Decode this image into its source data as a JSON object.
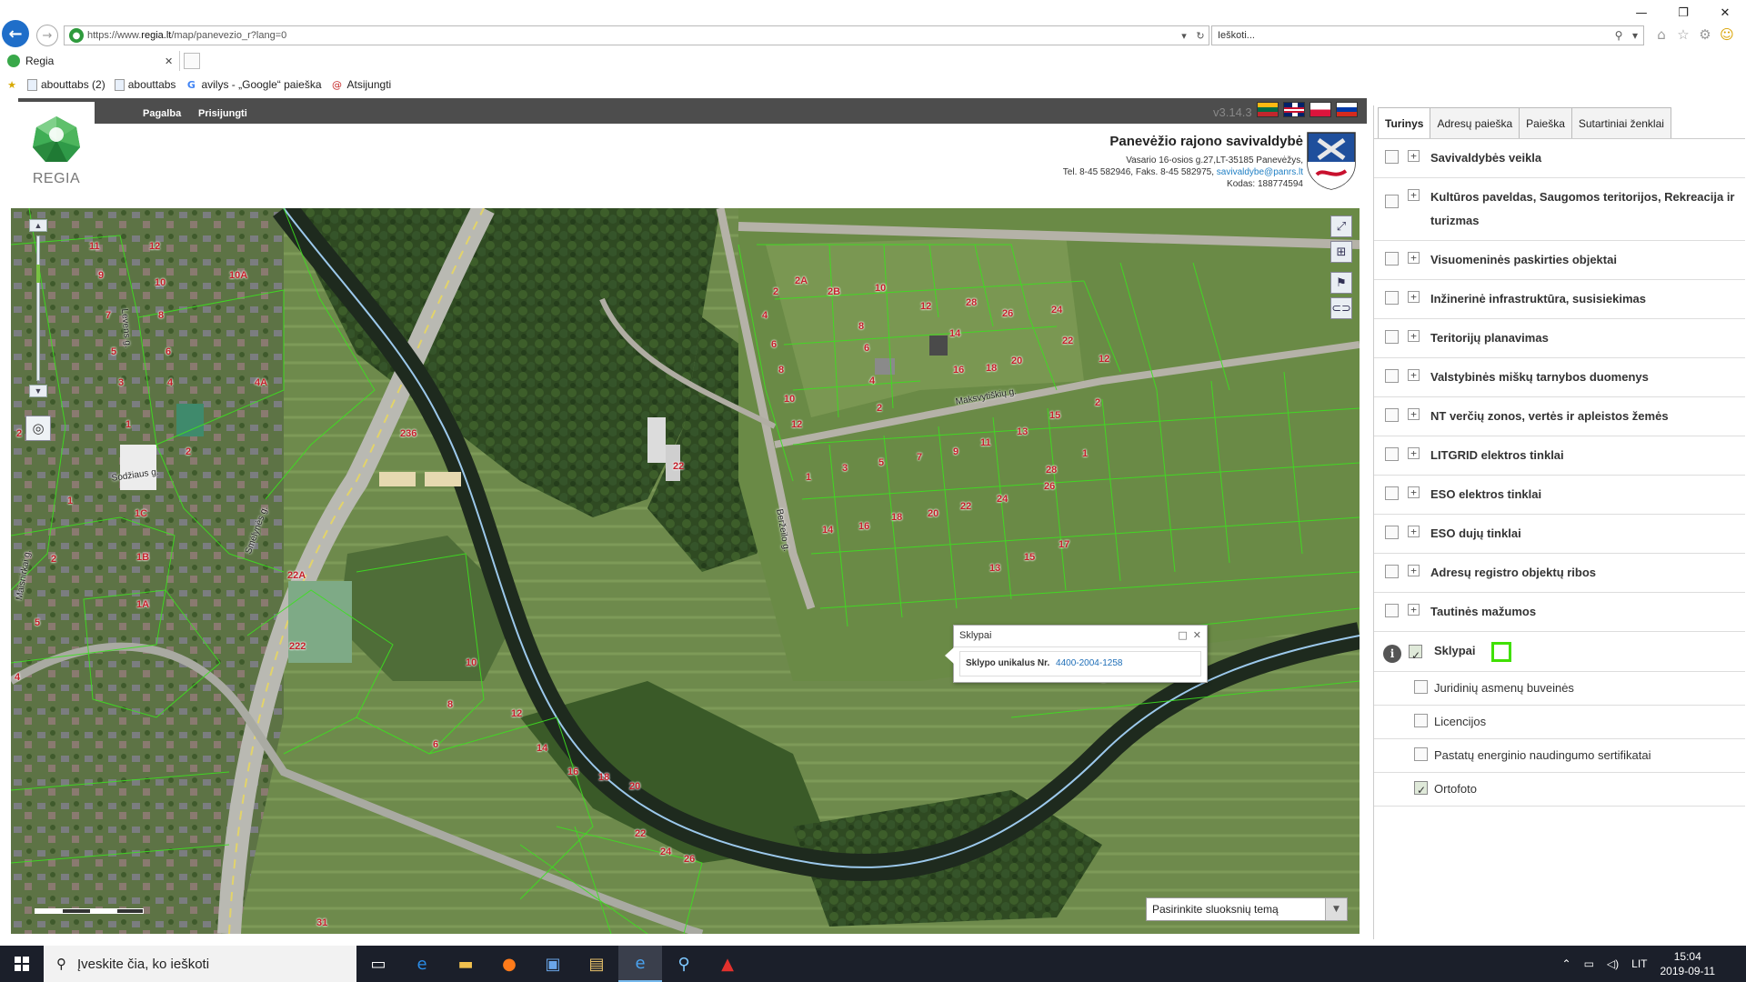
{
  "window": {
    "minimize": "—",
    "restore": "❐",
    "close": "✕"
  },
  "browser": {
    "url_prefix": "https://www.",
    "url_host": "regia.lt",
    "url_path": "/map/panevezio_r?lang=0",
    "search_placeholder": "Ieškoti...",
    "tab_title": "Regia",
    "favorites": [
      {
        "label": "abouttabs (2)",
        "icon": "page-icon"
      },
      {
        "label": "abouttabs",
        "icon": "page-icon"
      },
      {
        "label": "avilys - „Google“ paieška",
        "icon": "google-icon"
      },
      {
        "label": "Atsijungti",
        "icon": "at-icon"
      }
    ]
  },
  "app": {
    "logo_text": "REGIA",
    "menu": [
      "Pagalba",
      "Prisijungti"
    ],
    "version": "v3.14.3",
    "languages": [
      "lt",
      "en",
      "pl",
      "ru"
    ],
    "municipality": {
      "name": "Panevėžio rajono savivaldybė",
      "address": "Vasario 16-osios g.27,LT-35185 Panevėžys,",
      "phone_fax": "Tel. 8-45 582946, Faks. 8-45 582975,",
      "email": "savivaldybe@panrs.lt",
      "code": "Kodas: 188774594"
    }
  },
  "map": {
    "street_labels": [
      "Smėlynės g.",
      "Beržeilo g.",
      "Maksvytiškių g.",
      "Sodžiaus g.",
      "Levens g.",
      "Maisnirkai g."
    ],
    "parcel_labels": [
      {
        "t": "11"
      },
      {
        "t": "12"
      },
      {
        "t": "9"
      },
      {
        "t": "10"
      },
      {
        "t": "10A"
      },
      {
        "t": "7"
      },
      {
        "t": "8"
      },
      {
        "t": "5"
      },
      {
        "t": "6"
      },
      {
        "t": "3"
      },
      {
        "t": "4"
      },
      {
        "t": "4A"
      },
      {
        "t": "1"
      },
      {
        "t": "2"
      },
      {
        "t": "2"
      },
      {
        "t": "1"
      },
      {
        "t": "1C"
      },
      {
        "t": "1B"
      },
      {
        "t": "1A"
      },
      {
        "t": "2"
      },
      {
        "t": "5"
      },
      {
        "t": "4"
      },
      {
        "t": "236"
      },
      {
        "t": "22A"
      },
      {
        "t": "222"
      },
      {
        "t": "10"
      },
      {
        "t": "8"
      },
      {
        "t": "12"
      },
      {
        "t": "6"
      },
      {
        "t": "14"
      },
      {
        "t": "16"
      },
      {
        "t": "18"
      },
      {
        "t": "20"
      },
      {
        "t": "22"
      },
      {
        "t": "24"
      },
      {
        "t": "26"
      },
      {
        "t": "31"
      },
      {
        "t": "22"
      },
      {
        "t": "2"
      },
      {
        "t": "2A"
      },
      {
        "t": "2B"
      },
      {
        "t": "10"
      },
      {
        "t": "4"
      },
      {
        "t": "8"
      },
      {
        "t": "6"
      },
      {
        "t": "6"
      },
      {
        "t": "8"
      },
      {
        "t": "4"
      },
      {
        "t": "10"
      },
      {
        "t": "2"
      },
      {
        "t": "12"
      },
      {
        "t": "12"
      },
      {
        "t": "28"
      },
      {
        "t": "26"
      },
      {
        "t": "24"
      },
      {
        "t": "14"
      },
      {
        "t": "16"
      },
      {
        "t": "18"
      },
      {
        "t": "20"
      },
      {
        "t": "22"
      },
      {
        "t": "2"
      },
      {
        "t": "12"
      },
      {
        "t": "15"
      },
      {
        "t": "13"
      },
      {
        "t": "11"
      },
      {
        "t": "1"
      },
      {
        "t": "3"
      },
      {
        "t": "5"
      },
      {
        "t": "7"
      },
      {
        "t": "9"
      },
      {
        "t": "28"
      },
      {
        "t": "26"
      },
      {
        "t": "24"
      },
      {
        "t": "22"
      },
      {
        "t": "20"
      },
      {
        "t": "18"
      },
      {
        "t": "16"
      },
      {
        "t": "14"
      },
      {
        "t": "1"
      },
      {
        "t": "15"
      },
      {
        "t": "17"
      },
      {
        "t": "13"
      },
      {
        "t": "1"
      }
    ],
    "popup": {
      "title": "Sklypai",
      "label": "Sklypo unikalus Nr.",
      "value": "4400-2004-1258"
    },
    "layer_select": "Pasirinkite sluoksnių temą"
  },
  "panel": {
    "tabs": [
      "Turinys",
      "Adresų paieška",
      "Paieška",
      "Sutartiniai ženklai"
    ],
    "layers": [
      "Savivaldybės veikla",
      "Kultūros paveldas, Saugomos teritorijos, Rekreacija ir turizmas",
      "Visuomeninės paskirties objektai",
      "Inžinerinė infrastruktūra, susisiekimas",
      "Teritorijų planavimas",
      "Valstybinės miškų tarnybos duomenys",
      "NT verčių zonos, vertės ir apleistos žemės",
      "LITGRID elektros tinklai",
      "ESO elektros tinklai",
      "ESO dujų tinklai",
      "Adresų registro objektų ribos",
      "Tautinės mažumos"
    ],
    "active_layer": "Sklypai",
    "sublayers": [
      {
        "label": "Juridinių asmenų buveinės",
        "checked": false
      },
      {
        "label": "Licencijos",
        "checked": false
      },
      {
        "label": "Pastatų energinio naudingumo sertifikatai",
        "checked": false
      },
      {
        "label": "Ortofoto",
        "checked": true
      }
    ]
  },
  "taskbar": {
    "search_placeholder": "Įveskite čia, ko ieškoti",
    "lang": "LIT",
    "time": "15:04",
    "date": "2019-09-11"
  }
}
